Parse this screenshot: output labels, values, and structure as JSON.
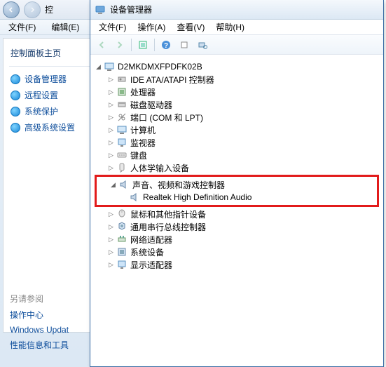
{
  "bg": {
    "addr_frag": "控",
    "menu_file": "文件(F)",
    "menu_edit": "编辑(E)",
    "sidebar_head": "控制面板主页",
    "items": [
      "设备管理器",
      "远程设置",
      "系统保护",
      "高级系统设置"
    ],
    "see_also": "另请参阅",
    "links": [
      "操作中心",
      "Windows Updat",
      "性能信息和工具"
    ]
  },
  "dm": {
    "title": "设备管理器",
    "menu": {
      "file": "文件(F)",
      "action": "操作(A)",
      "view": "查看(V)",
      "help": "帮助(H)"
    },
    "root": "D2MKDMXFPDFK02B",
    "cats": [
      "IDE ATA/ATAPI 控制器",
      "处理器",
      "磁盘驱动器",
      "端口 (COM 和 LPT)",
      "计算机",
      "监视器",
      "键盘",
      "人体学输入设备"
    ],
    "sound_cat": "声音、视频和游戏控制器",
    "sound_dev": "Realtek High Definition Audio",
    "cats2": [
      "鼠标和其他指针设备",
      "通用串行总线控制器",
      "网络适配器",
      "系统设备",
      "显示适配器"
    ]
  }
}
